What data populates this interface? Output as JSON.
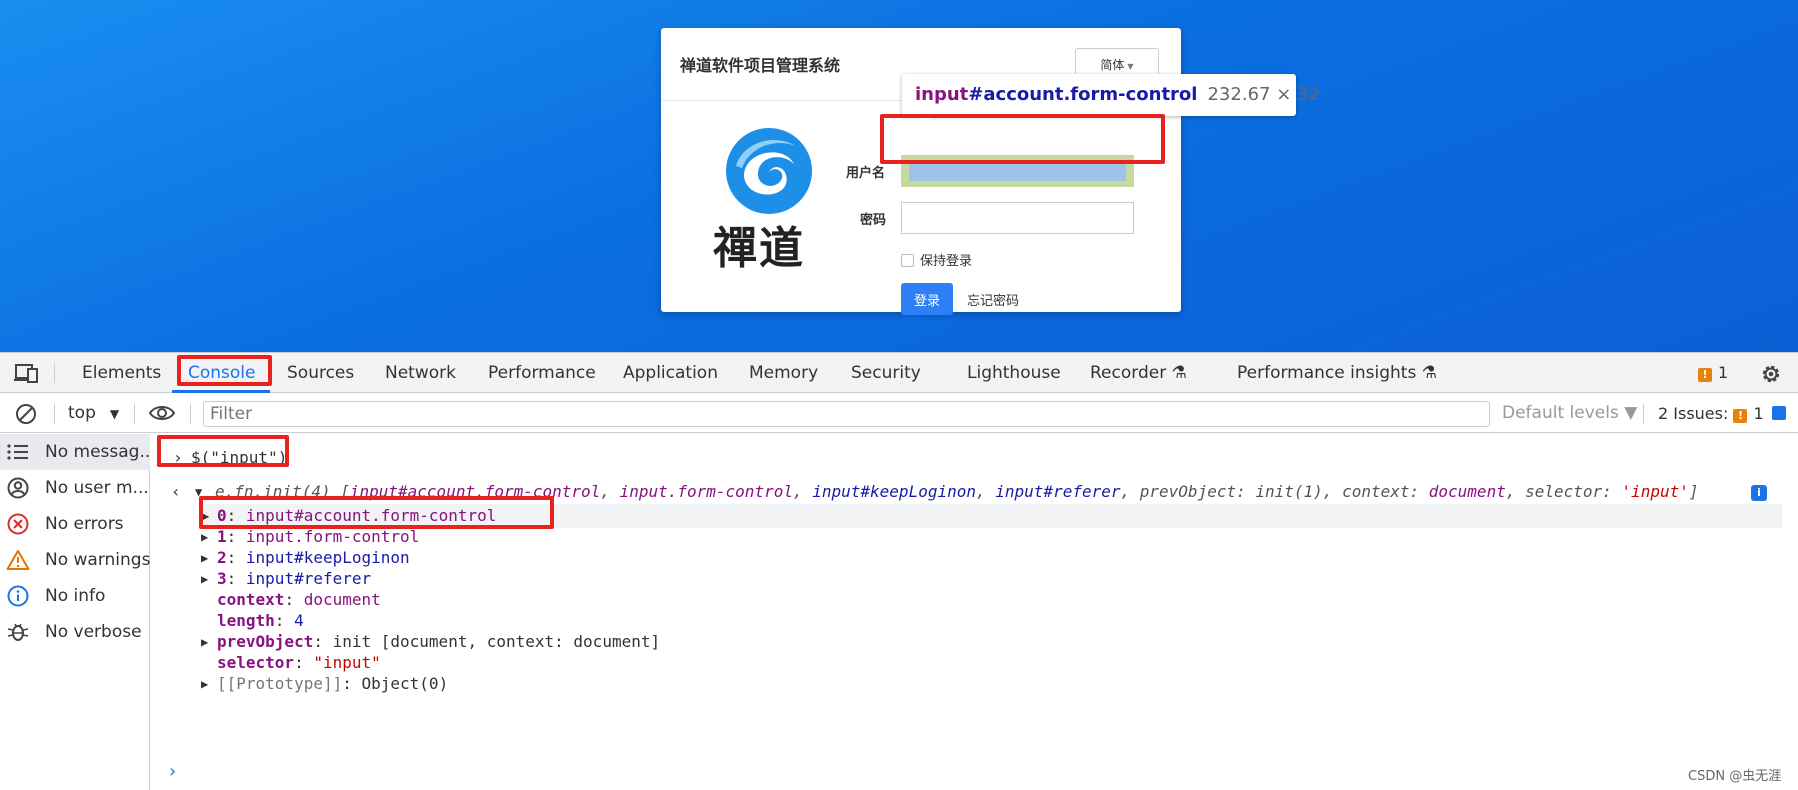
{
  "page": {
    "card_title": "禅道软件项目管理系统",
    "lang_label": "简体",
    "logo_text": "禪道",
    "username_label": "用户名",
    "password_label": "密码",
    "keep_login_label": "保持登录",
    "login_button": "登录",
    "forgot_password": "忘记密码"
  },
  "inspector_tooltip": {
    "tag": "input",
    "selector": "#account.form-control",
    "dimensions": "232.67 × 32"
  },
  "devtools": {
    "tabs": [
      "Elements",
      "Console",
      "Sources",
      "Network",
      "Performance",
      "Application",
      "Memory",
      "Security",
      "Lighthouse",
      "Recorder",
      "Performance insights"
    ],
    "active_tab": "Console",
    "issues_top_count": "1",
    "toolbar": {
      "context": "top",
      "filter_placeholder": "Filter",
      "default_levels": "Default levels",
      "issues_label": "2 Issues:",
      "issues_warn_count": "1",
      "issues_info_count": "1"
    },
    "sidebar": [
      {
        "label": "No messag...",
        "icon": "list-icon"
      },
      {
        "label": "No user m...",
        "icon": "user-icon"
      },
      {
        "label": "No errors",
        "icon": "error-icon"
      },
      {
        "label": "No warnings",
        "icon": "warning-icon"
      },
      {
        "label": "No info",
        "icon": "info-icon"
      },
      {
        "label": "No verbose",
        "icon": "bug-icon"
      }
    ],
    "console": {
      "input": "$(\"input\")",
      "result_prefix": "e.fn.init(4) [",
      "result_items": [
        "input#account.form-control",
        "input.form-control",
        "input#keepLoginon",
        "input#referer"
      ],
      "result_suffix_parts": {
        "prevObject_key": "prevObject",
        "prevObject_val": "init(1)",
        "context_key": "context",
        "context_val": "document",
        "selector_key": "selector",
        "selector_val": "'input'"
      },
      "rows": [
        {
          "key": "0",
          "val": "input#account.form-control",
          "expandable": true
        },
        {
          "key": "1",
          "val": "input.form-control",
          "expandable": true
        },
        {
          "key": "2",
          "val": "input#keepLoginon",
          "expandable": true
        },
        {
          "key": "3",
          "val": "input#referer",
          "expandable": true
        },
        {
          "key": "context",
          "val": "document",
          "expandable": false
        },
        {
          "key": "length",
          "val": "4",
          "expandable": false
        },
        {
          "key": "prevObject",
          "val": "init [document, context: document]",
          "expandable": true
        },
        {
          "key": "selector",
          "val": "\"input\"",
          "expandable": false
        },
        {
          "key": "[[Prototype]]",
          "val": "Object(0)",
          "expandable": true
        }
      ]
    }
  },
  "watermark": "CSDN @虫无涯",
  "colors": {
    "accent": "#1a73e8",
    "annotation_red": "#e8231f",
    "login_button": "#2e7ff5",
    "page_bg": "#0a6fe0"
  }
}
